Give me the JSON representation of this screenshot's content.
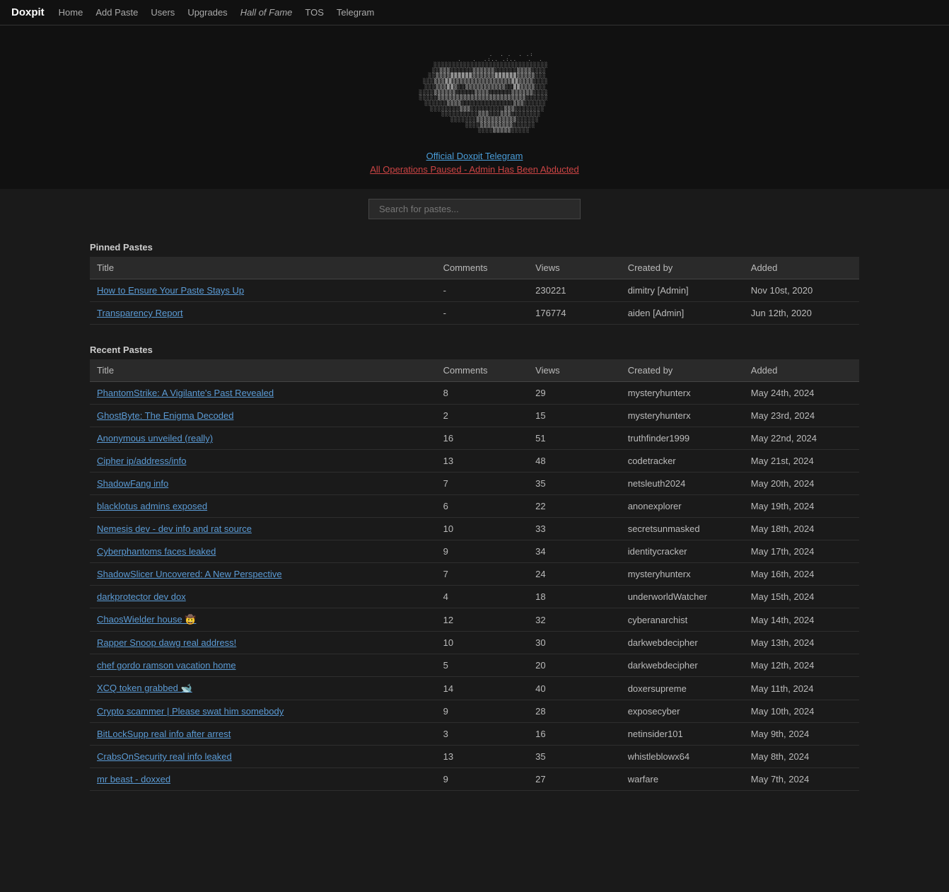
{
  "nav": {
    "brand": "Doxpit",
    "links": [
      {
        "label": "Home",
        "href": "#"
      },
      {
        "label": "Add Paste",
        "href": "#"
      },
      {
        "label": "Users",
        "href": "#"
      },
      {
        "label": "Upgrades",
        "href": "#"
      },
      {
        "label": "Hall of Fame",
        "href": "#",
        "class": "hall-of-fame"
      },
      {
        "label": "TOS",
        "href": "#"
      },
      {
        "label": "Telegram",
        "href": "#"
      }
    ]
  },
  "hero": {
    "telegram_link_text": "Official Doxpit Telegram",
    "paused_link_text": "All Operations Paused - Admin Has Been Abducted"
  },
  "search": {
    "placeholder": "Search for pastes..."
  },
  "pinned_section": {
    "title": "Pinned Pastes",
    "columns": [
      "Title",
      "Comments",
      "Views",
      "Created by",
      "Added"
    ],
    "rows": [
      {
        "title": "How to Ensure Your Paste Stays Up",
        "comments": "-",
        "views": "230221",
        "created_by": "dimitry [Admin]",
        "added": "Nov 10st, 2020"
      },
      {
        "title": "Transparency Report",
        "comments": "-",
        "views": "176774",
        "created_by": "aiden [Admin]",
        "added": "Jun 12th, 2020"
      }
    ]
  },
  "recent_section": {
    "title": "Recent Pastes",
    "columns": [
      "Title",
      "Comments",
      "Views",
      "Created by",
      "Added"
    ],
    "rows": [
      {
        "title": "PhantomStrike: A Vigilante's Past Revealed",
        "comments": "8",
        "views": "29",
        "created_by": "mysteryhunterx",
        "added": "May 24th, 2024"
      },
      {
        "title": "GhostByte: The Enigma Decoded",
        "comments": "2",
        "views": "15",
        "created_by": "mysteryhunterx",
        "added": "May 23rd, 2024"
      },
      {
        "title": "Anonymous unveiled (really)",
        "comments": "16",
        "views": "51",
        "created_by": "truthfinder1999",
        "added": "May 22nd, 2024"
      },
      {
        "title": "Cipher ip/address/info",
        "comments": "13",
        "views": "48",
        "created_by": "codetracker",
        "added": "May 21st, 2024"
      },
      {
        "title": "ShadowFang info",
        "comments": "7",
        "views": "35",
        "created_by": "netsleuth2024",
        "added": "May 20th, 2024"
      },
      {
        "title": "blacklotus admins exposed",
        "comments": "6",
        "views": "22",
        "created_by": "anonexplorer",
        "added": "May 19th, 2024"
      },
      {
        "title": "Nemesis dev - dev info and rat source",
        "comments": "10",
        "views": "33",
        "created_by": "secretsunmasked",
        "added": "May 18th, 2024"
      },
      {
        "title": "Cyberphantoms faces leaked",
        "comments": "9",
        "views": "34",
        "created_by": "identitycracker",
        "added": "May 17th, 2024"
      },
      {
        "title": "ShadowSlicer Uncovered: A New Perspective",
        "comments": "7",
        "views": "24",
        "created_by": "mysteryhunterx",
        "added": "May 16th, 2024"
      },
      {
        "title": "darkprotector dev dox",
        "comments": "4",
        "views": "18",
        "created_by": "underworldWatcher",
        "added": "May 15th, 2024"
      },
      {
        "title": "ChaosWielder house 🤠",
        "comments": "12",
        "views": "32",
        "created_by": "cyberanarchist",
        "added": "May 14th, 2024"
      },
      {
        "title": "Rapper Snoop dawg real address!",
        "comments": "10",
        "views": "30",
        "created_by": "darkwebdecipher",
        "added": "May 13th, 2024"
      },
      {
        "title": "chef gordo ramson vacation home",
        "comments": "5",
        "views": "20",
        "created_by": "darkwebdecipher",
        "added": "May 12th, 2024"
      },
      {
        "title": "XCQ token grabbed 🐋",
        "comments": "14",
        "views": "40",
        "created_by": "doxersupreme",
        "added": "May 11th, 2024"
      },
      {
        "title": "Crypto scammer | Please swat him somebody",
        "comments": "9",
        "views": "28",
        "created_by": "exposecyber",
        "added": "May 10th, 2024"
      },
      {
        "title": "BitLockSupp real info after arrest",
        "comments": "3",
        "views": "16",
        "created_by": "netinsider101",
        "added": "May 9th, 2024"
      },
      {
        "title": "CrabsOnSecurity real info leaked",
        "comments": "13",
        "views": "35",
        "created_by": "whistleblowx64",
        "added": "May 8th, 2024"
      },
      {
        "title": "mr beast - doxxed",
        "comments": "9",
        "views": "27",
        "created_by": "warfare",
        "added": "May 7th, 2024"
      }
    ]
  }
}
